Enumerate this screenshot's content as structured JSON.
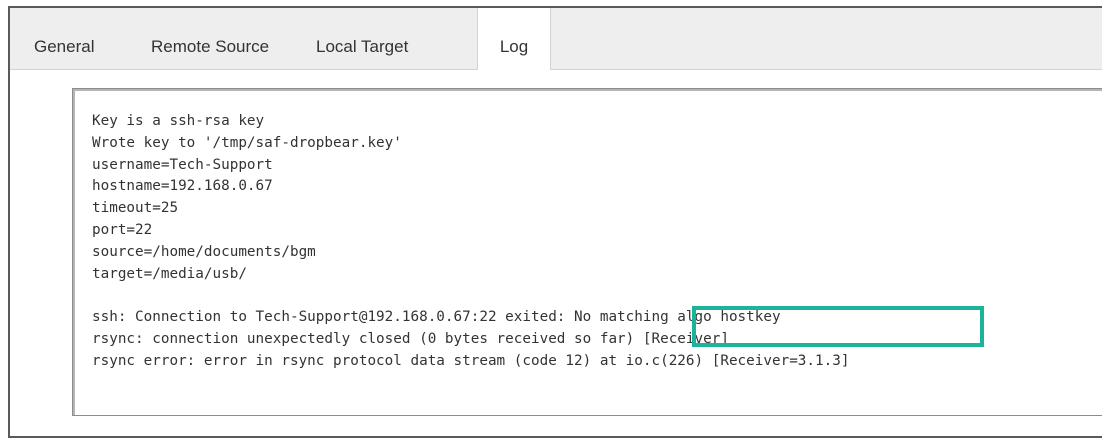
{
  "tabs": [
    {
      "label": "General",
      "active": false
    },
    {
      "label": "Remote Source",
      "active": false
    },
    {
      "label": "Local Target",
      "active": false
    },
    {
      "label": "Log",
      "active": true
    }
  ],
  "log": {
    "lines": [
      "Key is a ssh-rsa key",
      "Wrote key to '/tmp/saf-dropbear.key'",
      "username=Tech-Support",
      "hostname=192.168.0.67",
      "timeout=25",
      "port=22",
      "source=/home/documents/bgm",
      "target=/media/usb/",
      "",
      "ssh: Connection to Tech-Support@192.168.0.67:22 exited: No matching algo hostkey",
      "rsync: connection unexpectedly closed (0 bytes received so far) [Receiver]",
      "rsync error: error in rsync protocol data stream (code 12) at io.c(226) [Receiver=3.1.3]"
    ],
    "highlighted_text": "No matching algo hostkey"
  },
  "colors": {
    "highlight": "#1bb39a",
    "tabbar_bg": "#eeeeee",
    "text": "#333333"
  }
}
